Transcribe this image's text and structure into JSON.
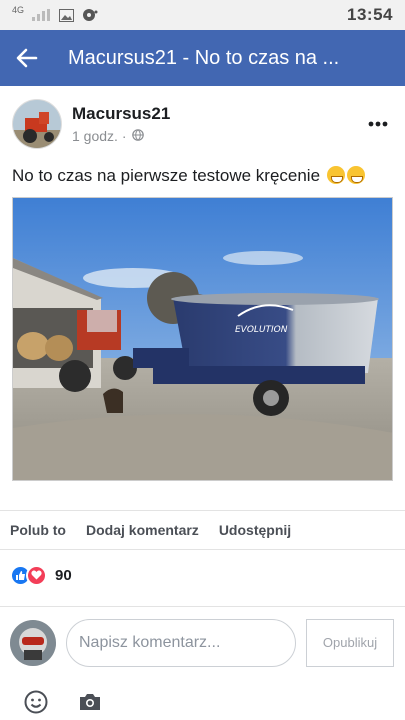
{
  "status_bar": {
    "network": "4G",
    "time": "13:54"
  },
  "app_bar": {
    "title": "Macursus21 - No to czas na ..."
  },
  "post": {
    "author": "Macursus21",
    "time": "1 godz. ·",
    "text": "No to czas na pierwsze testowe kręcenie",
    "image_label": "EVOLUTION"
  },
  "actions": {
    "like": "Polub to",
    "comment": "Dodaj komentarz",
    "share": "Udostępnij"
  },
  "reactions": {
    "count": "90"
  },
  "comment_box": {
    "placeholder": "Napisz komentarz...",
    "publish_label": "Opublikuj"
  },
  "colors": {
    "brand": "#4267b2",
    "like": "#1877f2",
    "love": "#f33e58"
  }
}
